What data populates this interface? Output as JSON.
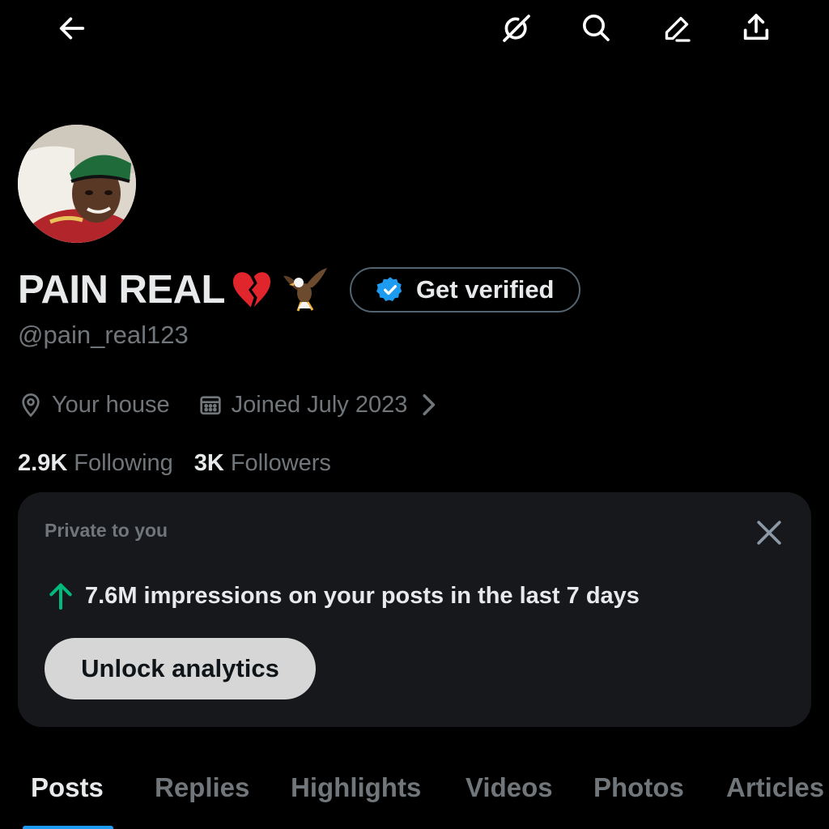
{
  "topbar": {
    "icons": [
      "back-arrow-icon",
      "grok-icon",
      "search-icon",
      "edit-icon",
      "share-icon"
    ]
  },
  "profile": {
    "display_name": "PAIN REAL",
    "name_emojis": [
      "broken-heart-emoji",
      "eagle-emoji"
    ],
    "verify_label": "Get verified",
    "handle": "@pain_real123",
    "location": "Your house",
    "joined": "Joined July 2023",
    "following_count": "2.9K",
    "following_label": "Following",
    "followers_count": "3K",
    "followers_label": "Followers"
  },
  "card": {
    "title": "Private to you",
    "stat_text": "7.6M impressions on your posts in the last 7 days",
    "button_label": "Unlock analytics"
  },
  "tabs": [
    {
      "label": "Posts",
      "active": true
    },
    {
      "label": "Replies",
      "active": false
    },
    {
      "label": "Highlights",
      "active": false
    },
    {
      "label": "Videos",
      "active": false
    },
    {
      "label": "Photos",
      "active": false
    },
    {
      "label": "Articles",
      "active": false
    }
  ],
  "colors": {
    "background": "#000000",
    "primary_text": "#e7e9ea",
    "secondary_text": "#71767b",
    "accent_blue": "#1d9bf0",
    "card_background": "#16181c",
    "up_arrow_green": "#00ba7c",
    "button_background": "#d6d6d6"
  }
}
